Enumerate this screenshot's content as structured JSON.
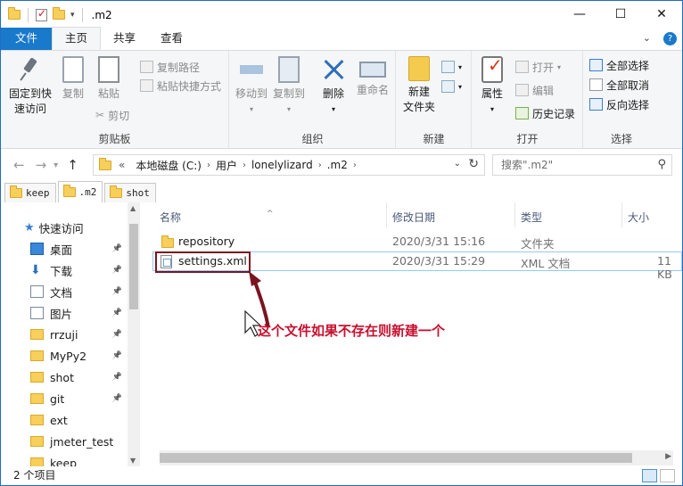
{
  "window": {
    "title": ".m2",
    "minimize": "—",
    "maximize": "☐",
    "close": "✕"
  },
  "ribbon": {
    "tabs": [
      "文件",
      "主页",
      "共享",
      "查看"
    ],
    "clipboard": {
      "label": "剪贴板",
      "pin": "固定到快速访问",
      "pin_l1": "固定到快",
      "pin_l2": "速访问",
      "copy": "复制",
      "paste": "粘贴",
      "copy_path": "复制路径",
      "paste_shortcut": "粘贴快捷方式",
      "cut": "剪切"
    },
    "organize": {
      "label": "组织",
      "move_to": "移动到",
      "copy_to": "复制到",
      "delete": "删除",
      "rename": "重命名"
    },
    "new": {
      "label": "新建",
      "new_folder_l1": "新建",
      "new_folder_l2": "文件夹"
    },
    "open": {
      "label": "打开",
      "properties": "属性",
      "open": "打开",
      "edit": "编辑",
      "history": "历史记录"
    },
    "select": {
      "label": "选择",
      "select_all": "全部选择",
      "select_none": "全部取消",
      "invert": "反向选择"
    }
  },
  "address": {
    "crumbs": [
      "«",
      "本地磁盘 (C:)",
      "用户",
      "lonelylizard",
      ".m2"
    ],
    "search_placeholder": "搜索\".m2\""
  },
  "quick_tabs": [
    "keep",
    ".m2",
    "shot"
  ],
  "nav_pane": {
    "quick_access": "快速访问",
    "items": [
      {
        "label": "桌面",
        "icon": "desktop-icon",
        "pinned": true
      },
      {
        "label": "下载",
        "icon": "download-icon",
        "pinned": true
      },
      {
        "label": "文档",
        "icon": "documents-icon",
        "pinned": true
      },
      {
        "label": "图片",
        "icon": "pictures-icon",
        "pinned": true
      },
      {
        "label": "rrzuji",
        "icon": "folder-icon",
        "pinned": true
      },
      {
        "label": "MyPy2",
        "icon": "folder-icon",
        "pinned": true
      },
      {
        "label": "shot",
        "icon": "folder-icon",
        "pinned": true
      },
      {
        "label": "git",
        "icon": "folder-icon",
        "pinned": true
      },
      {
        "label": "ext",
        "icon": "folder-icon",
        "pinned": false
      },
      {
        "label": "jmeter_test",
        "icon": "folder-icon",
        "pinned": false
      },
      {
        "label": "keep",
        "icon": "folder-icon",
        "pinned": false
      }
    ]
  },
  "file_list": {
    "columns": [
      "名称",
      "修改日期",
      "类型",
      "大小"
    ],
    "rows": [
      {
        "name": "repository",
        "modified": "2020/3/31 15:16",
        "type": "文件夹",
        "size": ""
      },
      {
        "name": "settings.xml",
        "modified": "2020/3/31 15:29",
        "type": "XML 文档",
        "size": "11 KB"
      }
    ]
  },
  "status": {
    "count": "2 个项目"
  },
  "annotation": {
    "text": "这个文件如果不存在则新建一个",
    "color": "#c8102e"
  },
  "colors": {
    "accent": "#1979ca",
    "annotation_box": "#7a1420"
  }
}
